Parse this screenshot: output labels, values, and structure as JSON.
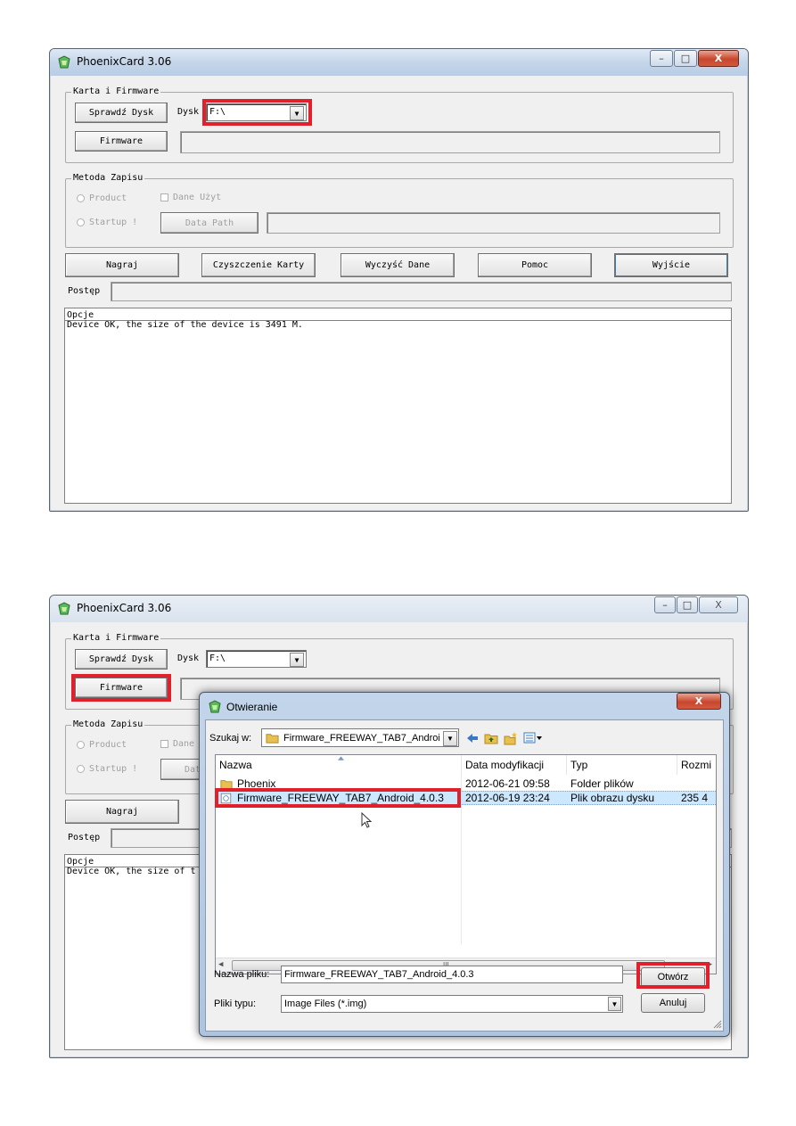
{
  "window1": {
    "title": "PhoenixCard 3.06",
    "minimize": "–",
    "maximize": "□",
    "close": "X"
  },
  "window2": {
    "title": "PhoenixCard 3.06",
    "close": "X"
  },
  "card_group": {
    "label": "Karta i Firmware",
    "check_disk_button": "Sprawdź Dysk",
    "disk_label": "Dysk",
    "disk_value": "F:\\",
    "firmware_button": "Firmware"
  },
  "write_method": {
    "label": "Metoda Zapisu",
    "product_radio": "Product",
    "user_data_check": "Dane Użyt",
    "startup_radio": "Startup !",
    "data_path_button": "Data Path",
    "product_radio_short": "Product",
    "user_data_short": "Dane",
    "startup_short": "Startup !",
    "data_path_short": "Dat"
  },
  "actions": {
    "burn": "Nagraj",
    "clean_card": "Czyszczenie Karty",
    "clear_data": "Wyczyść Dane",
    "help": "Pomoc",
    "exit": "Wyjście"
  },
  "progress_label": "Postęp",
  "log": {
    "header": "Opcje",
    "line1": "Device OK, the size of the device is 3491 M.",
    "line1_clipped": "Device OK, the size of t"
  },
  "open_dialog": {
    "title": "Otwieranie",
    "close": "X",
    "look_in_label": "Szukaj w:",
    "look_in_value": "Firmware_FREEWAY_TAB7_Androic",
    "columns": [
      "Nazwa",
      "Data modyfikacji",
      "Typ",
      "Rozmi"
    ],
    "rows": [
      {
        "name": "Phoenix",
        "date": "2012-06-21 09:58",
        "type": "Folder plików",
        "size": ""
      },
      {
        "name": "Firmware_FREEWAY_TAB7_Android_4.0.3",
        "date": "2012-06-19 23:24",
        "type": "Plik obrazu dysku",
        "size": "235 4"
      }
    ],
    "scroll_mark": "III",
    "filename_label": "Nazwa pliku:",
    "filename_value": "Firmware_FREEWAY_TAB7_Android_4.0.3",
    "filetype_label": "Pliki typu:",
    "filetype_value": "Image Files (*.img)",
    "open_button": "Otwórz",
    "cancel_button": "Anuluj"
  },
  "colors": {
    "highlight": "#e0202a",
    "selected_row": "#cce8ff"
  }
}
